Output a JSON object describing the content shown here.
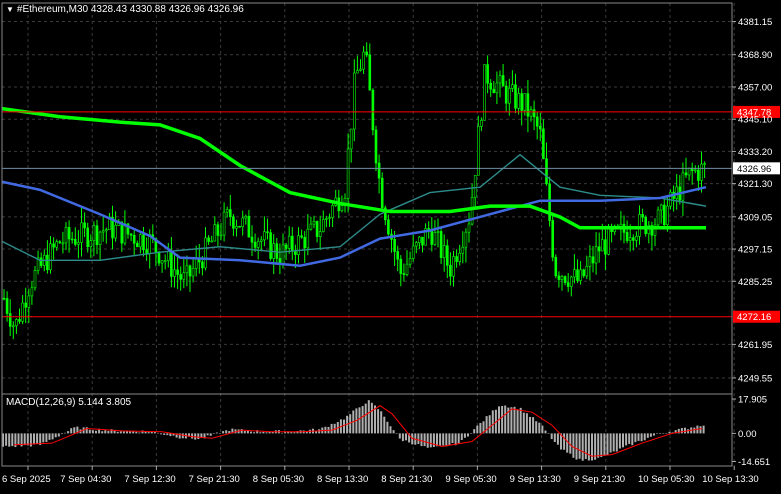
{
  "header": {
    "symbol": "#Ethereum,M30",
    "ohlc": "4328.43 4330.88 4326.96 4326.96"
  },
  "macd_header": {
    "label": "MACD(12,26,9)",
    "values": "5.144 3.805"
  },
  "colors": {
    "background": "#000000",
    "grid": "#3a3a3a",
    "candles": "#00ff00",
    "ma_slow": "#00ff00",
    "ma_mid": "#4169e1",
    "ma_fast": "#2e8b8b",
    "level_line": "#ff0000",
    "price_line": "#6f8fa8",
    "macd_hist": "#b0b0b0",
    "macd_signal": "#ff0000"
  },
  "chart_data": {
    "type": "candlestick",
    "price_axis_labels": [
      "4381.15",
      "4368.90",
      "4357.00",
      "4345.10",
      "4333.20",
      "4321.30",
      "4309.05",
      "4297.15",
      "4285.25",
      "4261.95",
      "4249.55"
    ],
    "time_axis_labels": [
      "6 Sep 2025",
      "7 Sep 04:30",
      "7 Sep 12:30",
      "7 Sep 21:30",
      "8 Sep 05:30",
      "8 Sep 13:30",
      "8 Sep 21:30",
      "9 Sep 05:30",
      "9 Sep 13:30",
      "9 Sep 21:30",
      "10 Sep 05:30",
      "10 Sep 13:30"
    ],
    "ylim": [
      4244,
      4388
    ],
    "levels": [
      {
        "label": "4347.78",
        "value": 4347.78
      },
      {
        "label": "4272.16",
        "value": 4272.16
      }
    ],
    "current_price": {
      "label": "4326.96",
      "value": 4326.96
    },
    "macd": {
      "axis_labels": [
        "17.905",
        "0.00",
        "-14.651"
      ],
      "ylim": [
        -17,
        20
      ]
    }
  }
}
